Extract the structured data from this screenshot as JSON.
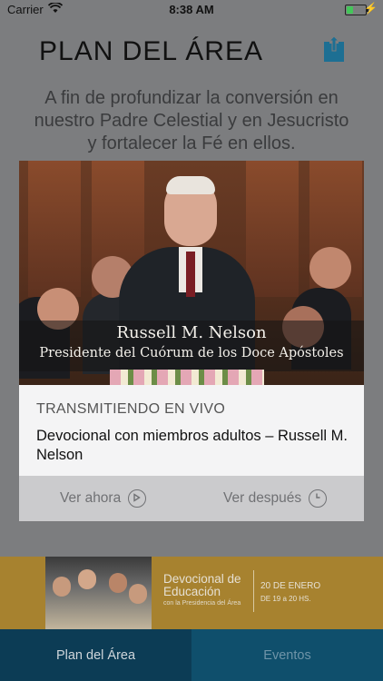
{
  "status": {
    "carrier": "Carrier",
    "time": "8:38 AM"
  },
  "header": {
    "title": "PLAN DEL ÁREA",
    "share_icon": "share-icon"
  },
  "subtitle": "A fin de profundizar la conversión en nuestro Padre Celestial y en Jesucristo y fortalecer la Fé en ellos.",
  "video": {
    "caption_name": "Russell M. Nelson",
    "caption_role": "Presidente del Cuórum de los Doce Apóstoles"
  },
  "live": {
    "label": "TRANSMITIENDO EN VIVO",
    "title": "Devocional con miembros adultos – Russell M. Nelson"
  },
  "actions": {
    "watch_now": "Ver ahora",
    "watch_later": "Ver después"
  },
  "promo": {
    "title": "Devocional de Educación",
    "subtitle": "con la Presidencia del Área",
    "date": "20 DE ENERO",
    "time": "DE 19 a 20 HS."
  },
  "tabs": [
    {
      "label": "Plan del Área",
      "active": true
    },
    {
      "label": "Eventos",
      "active": false
    }
  ],
  "colors": {
    "tab_active": "#0c3c55",
    "tab_inactive": "#0f4f6c",
    "promo_bg": "#a7822f",
    "accent": "#1a6f97"
  }
}
